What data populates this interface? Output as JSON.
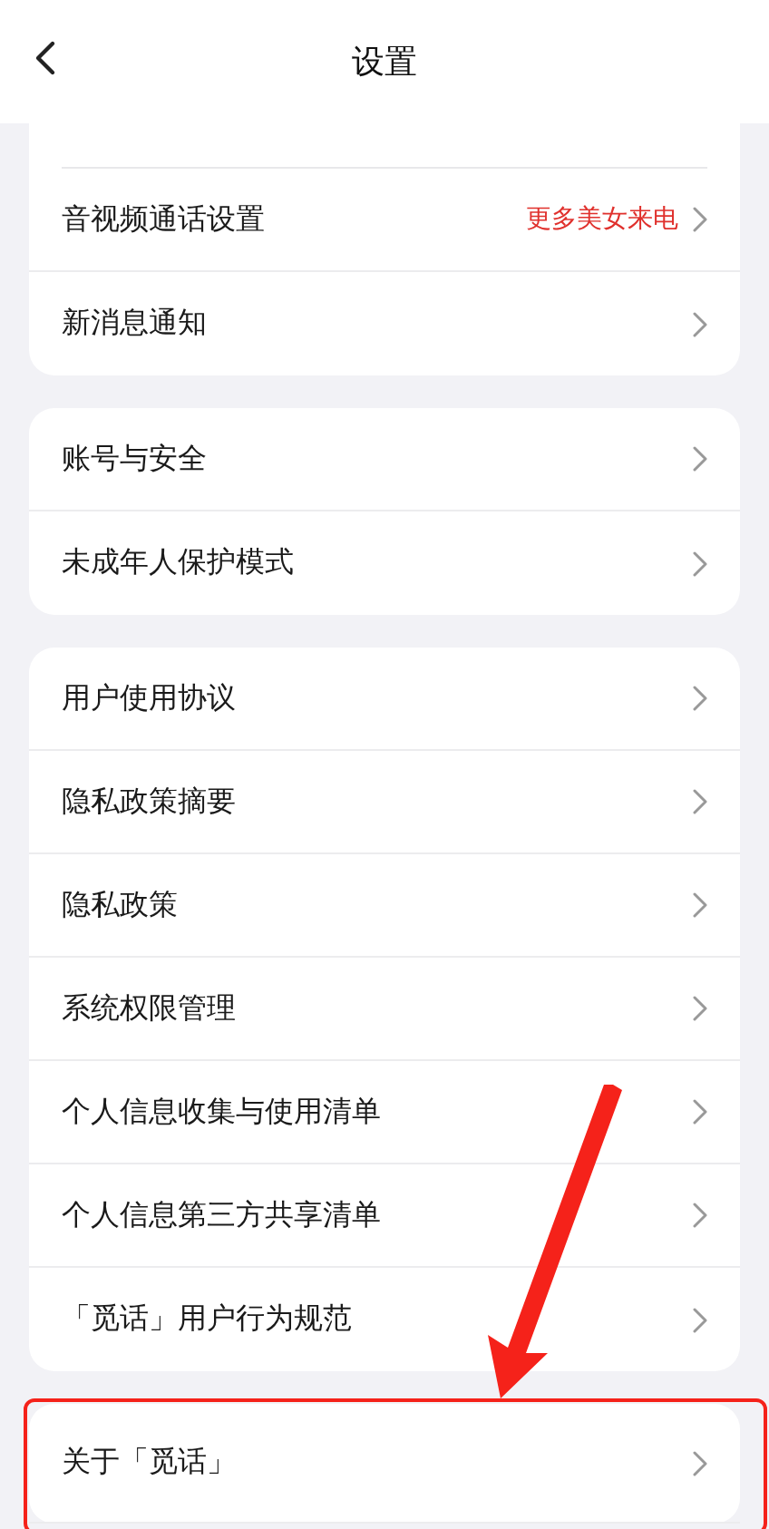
{
  "header": {
    "title": "设置"
  },
  "groups": [
    {
      "cut_top": true,
      "items": [
        {
          "label": "音视频通话设置",
          "note": "更多美女来电"
        },
        {
          "label": "新消息通知"
        }
      ]
    },
    {
      "items": [
        {
          "label": "账号与安全"
        },
        {
          "label": "未成年人保护模式"
        }
      ]
    },
    {
      "items": [
        {
          "label": "用户使用协议"
        },
        {
          "label": "隐私政策摘要"
        },
        {
          "label": "隐私政策"
        },
        {
          "label": "系统权限管理"
        },
        {
          "label": "个人信息收集与使用清单"
        },
        {
          "label": "个人信息第三方共享清单"
        },
        {
          "label": "「觅话」用户行为规范"
        }
      ]
    },
    {
      "highlighted": true,
      "items": [
        {
          "label": "关于「觅话」"
        }
      ]
    }
  ]
}
